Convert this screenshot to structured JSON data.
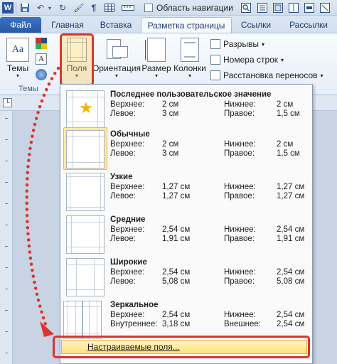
{
  "qat": {
    "nav_checkbox_label": "Область навигации",
    "icons": [
      "word-icon",
      "save-icon",
      "undo-icon",
      "format-painter-icon",
      "paragraph-icon",
      "table-icon"
    ]
  },
  "tabs": {
    "file": "Файл",
    "home": "Главная",
    "insert": "Вставка",
    "page_layout": "Разметка страницы",
    "references": "Ссылки",
    "mailings": "Рассылки"
  },
  "ribbon": {
    "themes": "Темы",
    "themes_group": "Темы",
    "margins": "Поля",
    "orientation": "Ориентация",
    "size": "Размер",
    "columns": "Колонки",
    "breaks": "Разрывы",
    "line_numbers": "Номера строк",
    "hyphenation": "Расстановка переносов"
  },
  "margins_menu": {
    "entries": [
      {
        "name": "Последнее пользовательское значение",
        "l1": "Верхнее:",
        "v1": "2 см",
        "l2": "Нижнее:",
        "v2": "2 см",
        "l3": "Левое:",
        "v3": "3 см",
        "l4": "Правое:",
        "v4": "1,5 см"
      },
      {
        "name": "Обычные",
        "l1": "Верхнее:",
        "v1": "2 см",
        "l2": "Нижнее:",
        "v2": "2 см",
        "l3": "Левое:",
        "v3": "3 см",
        "l4": "Правое:",
        "v4": "1,5 см"
      },
      {
        "name": "Узкие",
        "l1": "Верхнее:",
        "v1": "1,27 см",
        "l2": "Нижнее:",
        "v2": "1,27 см",
        "l3": "Левое:",
        "v3": "1,27 см",
        "l4": "Правое:",
        "v4": "1,27 см"
      },
      {
        "name": "Средние",
        "l1": "Верхнее:",
        "v1": "2,54 см",
        "l2": "Нижнее:",
        "v2": "2,54 см",
        "l3": "Левое:",
        "v3": "1,91 см",
        "l4": "Правое:",
        "v4": "1,91 см"
      },
      {
        "name": "Широкие",
        "l1": "Верхнее:",
        "v1": "2,54 см",
        "l2": "Нижнее:",
        "v2": "2,54 см",
        "l3": "Левое:",
        "v3": "5,08 см",
        "l4": "Правое:",
        "v4": "5,08 см"
      },
      {
        "name": "Зеркальное",
        "l1": "Верхнее:",
        "v1": "2,54 см",
        "l2": "Нижнее:",
        "v2": "2,54 см",
        "l3": "Внутреннее:",
        "v3": "3,18 см",
        "l4": "Внешнее:",
        "v4": "2,54 см"
      }
    ],
    "custom": "Настраиваемые поля..."
  },
  "colors": {
    "annotation": "#e0332b",
    "selected": "#ffe9a5",
    "file_tab": "#2a5aa5"
  }
}
